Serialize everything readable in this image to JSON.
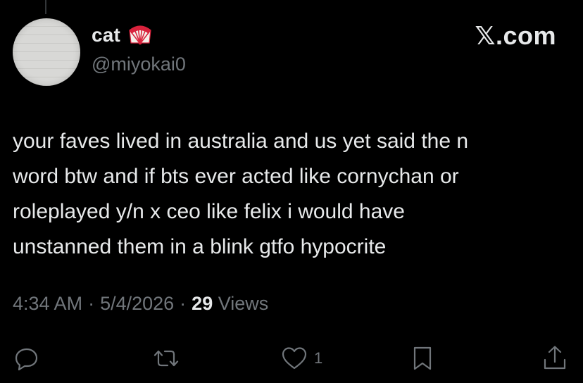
{
  "author": {
    "display_name": "cat",
    "handle": "@miyokai0",
    "badge_icon": "folding-fan-icon",
    "avatar_icon": "avatar-image"
  },
  "header": {
    "brand_label": "𝕏.com"
  },
  "tweet": {
    "text": "your faves lived in australia and us yet said the n\nword btw and if bts ever acted like cornychan or\nroleplayed y/n x ceo like felix i would have\nunstanned them in a blink gtfo hypocrite",
    "time": "4:34 AM",
    "date": "5/4/2026",
    "separator": "·",
    "views_count": "29",
    "views_label": "Views"
  },
  "actions": {
    "reply_icon": "reply-icon",
    "retweet_icon": "retweet-icon",
    "like_icon": "heart-icon",
    "like_count": "1",
    "bookmark_icon": "bookmark-icon",
    "share_icon": "share-icon"
  },
  "colors": {
    "background": "#000000",
    "primary_text": "#e7e9ea",
    "secondary_text": "#71767b",
    "fan_red": "#d9223c"
  }
}
